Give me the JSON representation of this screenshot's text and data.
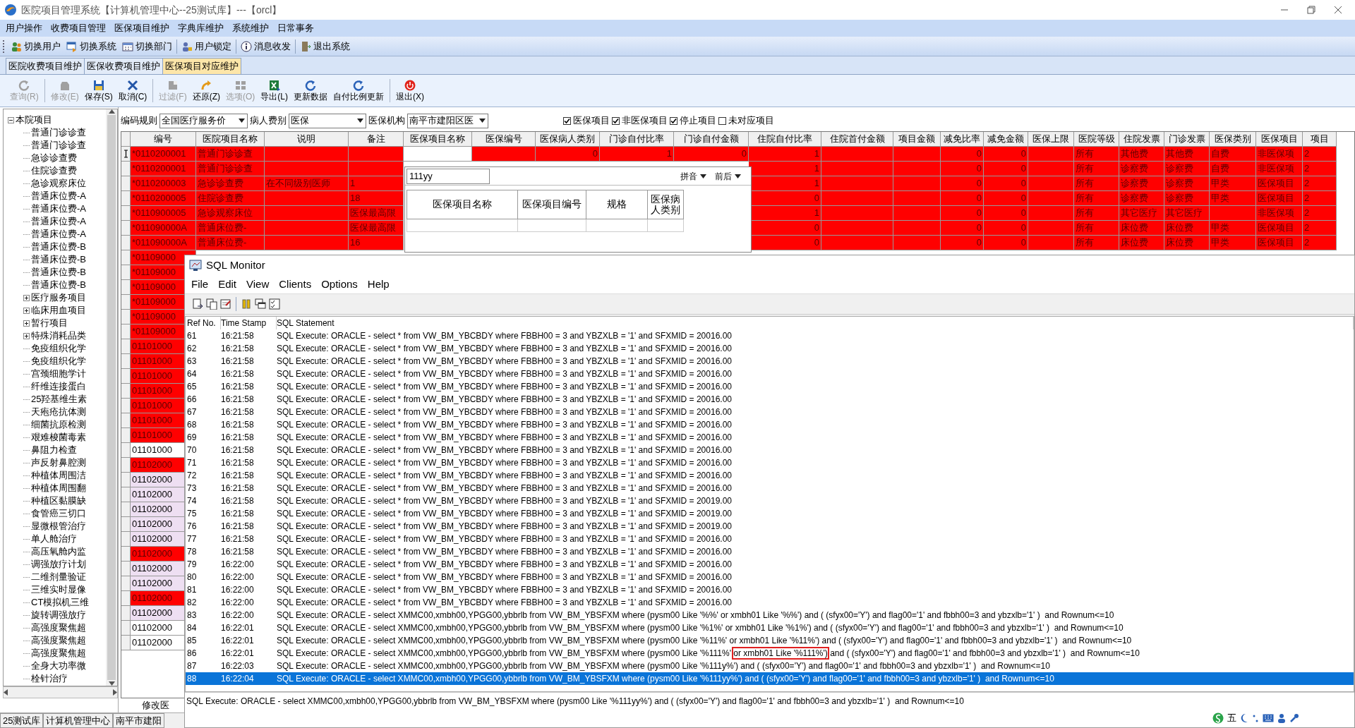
{
  "window": {
    "title": "医院项目管理系统【计算机管理中心--25测试库】---【orcl】"
  },
  "menu": [
    "用户操作",
    "收费项目管理",
    "医保项目维护",
    "字典库维护",
    "系统维护",
    "日常事务"
  ],
  "toolbar": [
    {
      "label": "切换用户",
      "separator_before": false
    },
    {
      "label": "切换系统",
      "separator_before": false
    },
    {
      "label": "切换部门",
      "separator_before": false
    },
    {
      "label": "用户锁定",
      "separator_before": true
    },
    {
      "label": "消息收发",
      "separator_before": true
    },
    {
      "label": "退出系统",
      "separator_before": true
    }
  ],
  "tabs": [
    {
      "label": "医院收费项目维护",
      "selected": false
    },
    {
      "label": "医保收费项目维护",
      "selected": false
    },
    {
      "label": "医保项目对应维护",
      "selected": true
    }
  ],
  "actions": [
    {
      "label": "查询(R)",
      "disabled": true,
      "separator_before": false
    },
    {
      "label": "修改(E)",
      "disabled": true,
      "separator_before": true
    },
    {
      "label": "保存(S)",
      "disabled": false,
      "separator_before": false
    },
    {
      "label": "取消(C)",
      "disabled": false,
      "separator_before": false
    },
    {
      "label": "过滤(F)",
      "disabled": true,
      "separator_before": true
    },
    {
      "label": "还原(Z)",
      "disabled": false,
      "separator_before": false
    },
    {
      "label": "选项(O)",
      "disabled": true,
      "separator_before": false
    },
    {
      "label": "导出(L)",
      "disabled": false,
      "separator_before": false
    },
    {
      "label": "更新数据",
      "disabled": false,
      "separator_before": false
    },
    {
      "label": "自付比例更新",
      "disabled": false,
      "separator_before": false
    },
    {
      "label": "退出(X)",
      "disabled": false,
      "separator_before": true
    }
  ],
  "tree": {
    "label": "本院项目",
    "expanded": true,
    "children": [
      {
        "label": "普通门诊诊查"
      },
      {
        "label": "普通门诊诊查"
      },
      {
        "label": "急诊诊查费"
      },
      {
        "label": "住院诊查费"
      },
      {
        "label": "急诊观察床位"
      },
      {
        "label": "普通床位费-A"
      },
      {
        "label": "普通床位费-A"
      },
      {
        "label": "普通床位费-A"
      },
      {
        "label": "普通床位费-A"
      },
      {
        "label": "普通床位费-B"
      },
      {
        "label": "普通床位费-B"
      },
      {
        "label": "普通床位费-B"
      },
      {
        "label": "普通床位费-B"
      },
      {
        "label": "医疗服务项目",
        "expanded": false
      },
      {
        "label": "临床用血项目",
        "expanded": false
      },
      {
        "label": "暂行项目",
        "expanded": false
      },
      {
        "label": "特殊消耗品类",
        "expanded": false
      },
      {
        "label": "免疫组织化学"
      },
      {
        "label": "免疫组织化学"
      },
      {
        "label": "宫颈细胞学计"
      },
      {
        "label": "纤维连接蛋白"
      },
      {
        "label": "25羟基维生素"
      },
      {
        "label": "天疱疮抗体测"
      },
      {
        "label": "细菌抗原检测"
      },
      {
        "label": "艰难梭菌毒素"
      },
      {
        "label": "鼻阻力检查"
      },
      {
        "label": "声反射鼻腔测"
      },
      {
        "label": "种植体周围洁"
      },
      {
        "label": "种植体周围翻"
      },
      {
        "label": "种植区黏膜缺"
      },
      {
        "label": "食管癌三切口"
      },
      {
        "label": "显微根管治疗"
      },
      {
        "label": "单人舱治疗"
      },
      {
        "label": "高压氧舱内监"
      },
      {
        "label": "调强放疗计划"
      },
      {
        "label": "二维剂量验证"
      },
      {
        "label": "三维实时显像"
      },
      {
        "label": "CT模拟机三维"
      },
      {
        "label": "旋转调强放疗"
      },
      {
        "label": "高强度聚焦超"
      },
      {
        "label": "高强度聚焦超"
      },
      {
        "label": "高强度聚焦超"
      },
      {
        "label": "全身大功率微"
      },
      {
        "label": "栓针治疗"
      }
    ]
  },
  "filters": {
    "selects": [
      {
        "label": "编码规则",
        "value": "全国医疗服务价"
      },
      {
        "label": "病人费别",
        "value": "医保"
      },
      {
        "label": "医保机构",
        "value": "南平市建阳区医"
      }
    ],
    "checks": [
      {
        "label": "医保项目",
        "checked": true
      },
      {
        "label": "非医保项目",
        "checked": true
      },
      {
        "label": "停止项目",
        "checked": true
      },
      {
        "label": "未对应项目",
        "checked": false
      }
    ]
  },
  "grid": {
    "columns": [
      {
        "label": "编号",
        "editing": false
      },
      {
        "label": "医院项目名称",
        "editing": false
      },
      {
        "label": "说明",
        "editing": false
      },
      {
        "label": "备注",
        "editing": false
      },
      {
        "label": "医保项目名称",
        "editing": true
      },
      {
        "label": "医保编号",
        "editing": false
      },
      {
        "label": "医保病人类别",
        "editing": false
      },
      {
        "label": "门诊自付比率",
        "editing": false
      },
      {
        "label": "门诊自付金额",
        "editing": false
      },
      {
        "label": "住院自付比率",
        "editing": false
      },
      {
        "label": "住院首付金额",
        "editing": false
      },
      {
        "label": "项目金额",
        "editing": false
      },
      {
        "label": "减免比率",
        "editing": false
      },
      {
        "label": "减免金额",
        "editing": false
      },
      {
        "label": "医保上限",
        "editing": false
      },
      {
        "label": "医院等级",
        "editing": false
      },
      {
        "label": "住院发票",
        "editing": false
      },
      {
        "label": "门诊发票",
        "editing": false
      },
      {
        "label": "医保类别",
        "editing": false
      },
      {
        "label": "医保项目",
        "editing": false
      },
      {
        "label": "项目",
        "editing": false
      }
    ],
    "rows": [
      {
        "color": "#ff0000",
        "current": true,
        "cells": [
          "*0110200001",
          "普通门诊诊查",
          null,
          null,
          null,
          null,
          "0",
          "1",
          "0",
          "1",
          null,
          null,
          "0",
          "0",
          null,
          "所有",
          "其他费",
          "其他费",
          "自费",
          "非医保项",
          "2"
        ]
      },
      {
        "color": "#ff0000",
        "current": false,
        "cells": [
          "*0110200001",
          "普通门诊诊查",
          null,
          null,
          null,
          null,
          null,
          null,
          null,
          "1",
          null,
          null,
          "0",
          "0",
          null,
          "所有",
          "诊察费",
          "诊察费",
          "自费",
          "非医保项",
          "2"
        ]
      },
      {
        "color": "#ff0000",
        "current": false,
        "cells": [
          "*0110200003",
          "急诊诊查费",
          "在不同级别医师",
          "1",
          null,
          null,
          null,
          null,
          null,
          "1",
          null,
          null,
          "0",
          "0",
          null,
          "所有",
          "诊察费",
          "诊察费",
          "甲类",
          "医保项目",
          "2"
        ]
      },
      {
        "color": "#ff0000",
        "current": false,
        "cells": [
          "*0110200005",
          "住院诊查费",
          null,
          "18",
          null,
          null,
          null,
          null,
          null,
          "0",
          null,
          null,
          "0",
          "0",
          null,
          "所有",
          "诊察费",
          "诊察费",
          "甲类",
          "医保项目",
          "2"
        ]
      },
      {
        "color": "#ff0000",
        "current": false,
        "cells": [
          "*0110900005",
          "急诊观察床位",
          null,
          "医保最高限",
          null,
          null,
          null,
          null,
          null,
          "1",
          null,
          null,
          "0",
          "0",
          null,
          "所有",
          "其它医疗",
          "其它医疗",
          null,
          "非医保项",
          "2"
        ]
      },
      {
        "color": "#ff0000",
        "current": false,
        "cells": [
          "*011090000A",
          "普通床位费-",
          null,
          "医保最高限",
          null,
          null,
          null,
          null,
          null,
          "0",
          null,
          null,
          "0",
          "0",
          null,
          "所有",
          "床位费",
          "床位费",
          "甲类",
          "医保项目",
          "2"
        ]
      },
      {
        "color": "#ff0000",
        "current": false,
        "cells": [
          "*011090000A",
          "普通床位费-",
          null,
          "16",
          null,
          null,
          null,
          null,
          null,
          "0",
          null,
          null,
          "0",
          "0",
          null,
          "所有",
          "床位费",
          "床位费",
          "甲类",
          "医保项目",
          "2"
        ]
      },
      {
        "color": "#ff0000",
        "current": false,
        "cells": [
          "*01109000"
        ]
      },
      {
        "color": "#ff0000",
        "current": false,
        "cells": [
          "*01109000"
        ]
      },
      {
        "color": "#ff0000",
        "current": false,
        "cells": [
          "*01109000"
        ]
      },
      {
        "color": "#ff0000",
        "current": false,
        "cells": [
          "*01109000"
        ]
      },
      {
        "color": "#ff0000",
        "current": false,
        "cells": [
          "*01109000"
        ]
      },
      {
        "color": "#ff0000",
        "current": false,
        "cells": [
          "*01109000"
        ]
      },
      {
        "color": "#ff0000",
        "current": false,
        "cells": [
          "01101000"
        ]
      },
      {
        "color": "#ff0000",
        "current": false,
        "cells": [
          "01101000"
        ]
      },
      {
        "color": "#ff0000",
        "current": false,
        "cells": [
          "01101000"
        ]
      },
      {
        "color": "#ff0000",
        "current": false,
        "cells": [
          "01101000"
        ]
      },
      {
        "color": "#ff0000",
        "current": false,
        "cells": [
          "01101000"
        ]
      },
      {
        "color": "#ff0000",
        "current": false,
        "cells": [
          "01101000"
        ]
      },
      {
        "color": "#ff0000",
        "current": false,
        "cells": [
          "01101000"
        ]
      },
      {
        "color": "#ffffff",
        "current": false,
        "cells": [
          "01101000"
        ]
      },
      {
        "color": "#ff0000",
        "current": false,
        "cells": [
          "01102000"
        ]
      },
      {
        "color": "#eedff2",
        "current": false,
        "cells": [
          "01102000"
        ]
      },
      {
        "color": "#eedff2",
        "current": false,
        "cells": [
          "01102000"
        ]
      },
      {
        "color": "#eedff2",
        "current": false,
        "cells": [
          "01102000"
        ]
      },
      {
        "color": "#eedff2",
        "current": false,
        "cells": [
          "01102000"
        ]
      },
      {
        "color": "#eedff2",
        "current": false,
        "cells": [
          "01102000"
        ]
      },
      {
        "color": "#ff0000",
        "current": false,
        "cells": [
          "01102000"
        ]
      },
      {
        "color": "#eedff2",
        "current": false,
        "cells": [
          "01102000"
        ]
      },
      {
        "color": "#eedff2",
        "current": false,
        "cells": [
          "01102000"
        ]
      },
      {
        "color": "#ff0000",
        "current": false,
        "cells": [
          "01102000"
        ]
      },
      {
        "color": "#eedff2",
        "current": false,
        "cells": [
          "01102000"
        ]
      },
      {
        "color": "#ffffff",
        "current": false,
        "cells": [
          "01102000"
        ]
      },
      {
        "color": "#ffffff",
        "current": false,
        "cells": [
          "01102000"
        ]
      }
    ],
    "footer": "修改医"
  },
  "popup": {
    "search": "111yy",
    "dropdowns": [
      "拼音",
      "前后"
    ],
    "columns": [
      "医保项目名称",
      "医保项目编号",
      "规格",
      "医保病人类别"
    ]
  },
  "sql_monitor": {
    "title": "SQL Monitor",
    "menu": [
      "File",
      "Edit",
      "View",
      "Clients",
      "Options",
      "Help"
    ],
    "columns": [
      "Ref No.",
      "Time Stamp",
      "SQL Statement"
    ],
    "rows": [
      {
        "ref": "61",
        "time": "16:21:58",
        "statement": "SQL Execute: ORACLE - select * from VW_BM_YBCBDY where FBBH00 = 3 and YBZXLB = '1' and SFXMID = 20016.00",
        "selected": false
      },
      {
        "ref": "62",
        "time": "16:21:58",
        "statement": "SQL Execute: ORACLE - select * from VW_BM_YBCBDY where FBBH00 = 3 and YBZXLB = '1' and SFXMID = 20016.00",
        "selected": false
      },
      {
        "ref": "63",
        "time": "16:21:58",
        "statement": "SQL Execute: ORACLE - select * from VW_BM_YBCBDY where FBBH00 = 3 and YBZXLB = '1' and SFXMID = 20016.00",
        "selected": false
      },
      {
        "ref": "64",
        "time": "16:21:58",
        "statement": "SQL Execute: ORACLE - select * from VW_BM_YBCBDY where FBBH00 = 3 and YBZXLB = '1' and SFXMID = 20016.00",
        "selected": false
      },
      {
        "ref": "65",
        "time": "16:21:58",
        "statement": "SQL Execute: ORACLE - select * from VW_BM_YBCBDY where FBBH00 = 3 and YBZXLB = '1' and SFXMID = 20016.00",
        "selected": false
      },
      {
        "ref": "66",
        "time": "16:21:58",
        "statement": "SQL Execute: ORACLE - select * from VW_BM_YBCBDY where FBBH00 = 3 and YBZXLB = '1' and SFXMID = 20016.00",
        "selected": false
      },
      {
        "ref": "67",
        "time": "16:21:58",
        "statement": "SQL Execute: ORACLE - select * from VW_BM_YBCBDY where FBBH00 = 3 and YBZXLB = '1' and SFXMID = 20016.00",
        "selected": false
      },
      {
        "ref": "68",
        "time": "16:21:58",
        "statement": "SQL Execute: ORACLE - select * from VW_BM_YBCBDY where FBBH00 = 3 and YBZXLB = '1' and SFXMID = 20016.00",
        "selected": false
      },
      {
        "ref": "69",
        "time": "16:21:58",
        "statement": "SQL Execute: ORACLE - select * from VW_BM_YBCBDY where FBBH00 = 3 and YBZXLB = '1' and SFXMID = 20016.00",
        "selected": false
      },
      {
        "ref": "70",
        "time": "16:21:58",
        "statement": "SQL Execute: ORACLE - select * from VW_BM_YBCBDY where FBBH00 = 3 and YBZXLB = '1' and SFXMID = 20016.00",
        "selected": false
      },
      {
        "ref": "71",
        "time": "16:21:58",
        "statement": "SQL Execute: ORACLE - select * from VW_BM_YBCBDY where FBBH00 = 3 and YBZXLB = '1' and SFXMID = 20016.00",
        "selected": false
      },
      {
        "ref": "72",
        "time": "16:21:58",
        "statement": "SQL Execute: ORACLE - select * from VW_BM_YBCBDY where FBBH00 = 3 and YBZXLB = '1' and SFXMID = 20016.00",
        "selected": false
      },
      {
        "ref": "73",
        "time": "16:21:58",
        "statement": "SQL Execute: ORACLE - select * from VW_BM_YBCBDY where FBBH00 = 3 and YBZXLB = '1' and SFXMID = 20016.00",
        "selected": false
      },
      {
        "ref": "74",
        "time": "16:21:58",
        "statement": "SQL Execute: ORACLE - select * from VW_BM_YBCBDY where FBBH00 = 3 and YBZXLB = '1' and SFXMID = 20019.00",
        "selected": false
      },
      {
        "ref": "75",
        "time": "16:21:58",
        "statement": "SQL Execute: ORACLE - select * from VW_BM_YBCBDY where FBBH00 = 3 and YBZXLB = '1' and SFXMID = 20019.00",
        "selected": false
      },
      {
        "ref": "76",
        "time": "16:21:58",
        "statement": "SQL Execute: ORACLE - select * from VW_BM_YBCBDY where FBBH00 = 3 and YBZXLB = '1' and SFXMID = 20019.00",
        "selected": false
      },
      {
        "ref": "77",
        "time": "16:21:58",
        "statement": "SQL Execute: ORACLE - select * from VW_BM_YBCBDY where FBBH00 = 3 and YBZXLB = '1' and SFXMID = 20016.00",
        "selected": false
      },
      {
        "ref": "78",
        "time": "16:21:58",
        "statement": "SQL Execute: ORACLE - select * from VW_BM_YBCBDY where FBBH00 = 3 and YBZXLB = '1' and SFXMID = 20016.00",
        "selected": false
      },
      {
        "ref": "79",
        "time": "16:22:00",
        "statement": "SQL Execute: ORACLE - select * from VW_BM_YBCBDY where FBBH00 = 3 and YBZXLB = '1' and SFXMID = 20016.00",
        "selected": false
      },
      {
        "ref": "80",
        "time": "16:22:00",
        "statement": "SQL Execute: ORACLE - select * from VW_BM_YBCBDY where FBBH00 = 3 and YBZXLB = '1' and SFXMID = 20016.00",
        "selected": false
      },
      {
        "ref": "81",
        "time": "16:22:00",
        "statement": "SQL Execute: ORACLE - select * from VW_BM_YBCBDY where FBBH00 = 3 and YBZXLB = '1' and SFXMID = 20016.00",
        "selected": false
      },
      {
        "ref": "82",
        "time": "16:22:00",
        "statement": "SQL Execute: ORACLE - select * from VW_BM_YBCBDY where FBBH00 = 3 and YBZXLB = '1' and SFXMID = 20016.00",
        "selected": false
      },
      {
        "ref": "83",
        "time": "16:22:00",
        "statement": "SQL Execute: ORACLE - select XMMC00,xmbh00,YPGG00,ybbrlb from VW_BM_YBSFXM where (pysm00 Like '%%' or xmbh01 Like '%%') and ( (sfyx00='Y') and flag00='1' and fbbh00=3 and ybzxlb='1' )  and Rownum<=10",
        "selected": false
      },
      {
        "ref": "84",
        "time": "16:22:01",
        "statement": "SQL Execute: ORACLE - select XMMC00,xmbh00,YPGG00,ybbrlb from VW_BM_YBSFXM where (pysm00 Like '%1%' or xmbh01 Like '%1%') and ( (sfyx00='Y') and flag00='1' and fbbh00=3 and ybzxlb='1' )  and Rownum<=10",
        "selected": false
      },
      {
        "ref": "85",
        "time": "16:22:01",
        "statement": "SQL Execute: ORACLE - select XMMC00,xmbh00,YPGG00,ybbrlb from VW_BM_YBSFXM where (pysm00 Like '%11%' or xmbh01 Like '%11%') and ( (sfyx00='Y') and flag00='1' and fbbh00=3 and ybzxlb='1' )  and Rownum<=10",
        "selected": false
      },
      {
        "ref": "86",
        "time": "16:22:01",
        "statement": "SQL Execute: ORACLE - select XMMC00,xmbh00,YPGG00,ybbrlb from VW_BM_YBSFXM where (pysm00 Like '%111%'",
        "boxed": "or xmbh01 Like '%111%')",
        "statement_after": "and ( (sfyx00='Y') and flag00='1' and fbbh00=3 and ybzxlb='1' )  and Rownum<=10",
        "selected": false
      },
      {
        "ref": "87",
        "time": "16:22:03",
        "statement": "SQL Execute: ORACLE - select XMMC00,xmbh00,YPGG00,ybbrlb from VW_BM_YBSFXM where (pysm00 Like '%111y%') and ( (sfyx00='Y') and flag00='1' and fbbh00=3 and ybzxlb='1' )  and Rownum<=10",
        "selected": false
      },
      {
        "ref": "88",
        "time": "16:22:04",
        "statement": "SQL Execute: ORACLE - select XMMC00,xmbh00,YPGG00,ybbrlb from VW_BM_YBSFXM where (pysm00 Like '%111yy%') and ( (sfyx00='Y') and flag00='1' and fbbh00=3 and ybzxlb='1' )  and Rownum<=10",
        "selected": true
      }
    ],
    "detail": "SQL Execute: ORACLE - select XMMC00,xmbh00,YPGG00,ybbrlb from VW_BM_YBSFXM where (pysm00 Like '%111yy%') and ( (sfyx00='Y') and flag00='1' and fbbh00=3 and ybzxlb='1' )  and Rownum<=10"
  },
  "ime": {
    "label": "五"
  },
  "status_bar": [
    "25测试库",
    "计算机管理中心",
    "南平市建阳"
  ]
}
